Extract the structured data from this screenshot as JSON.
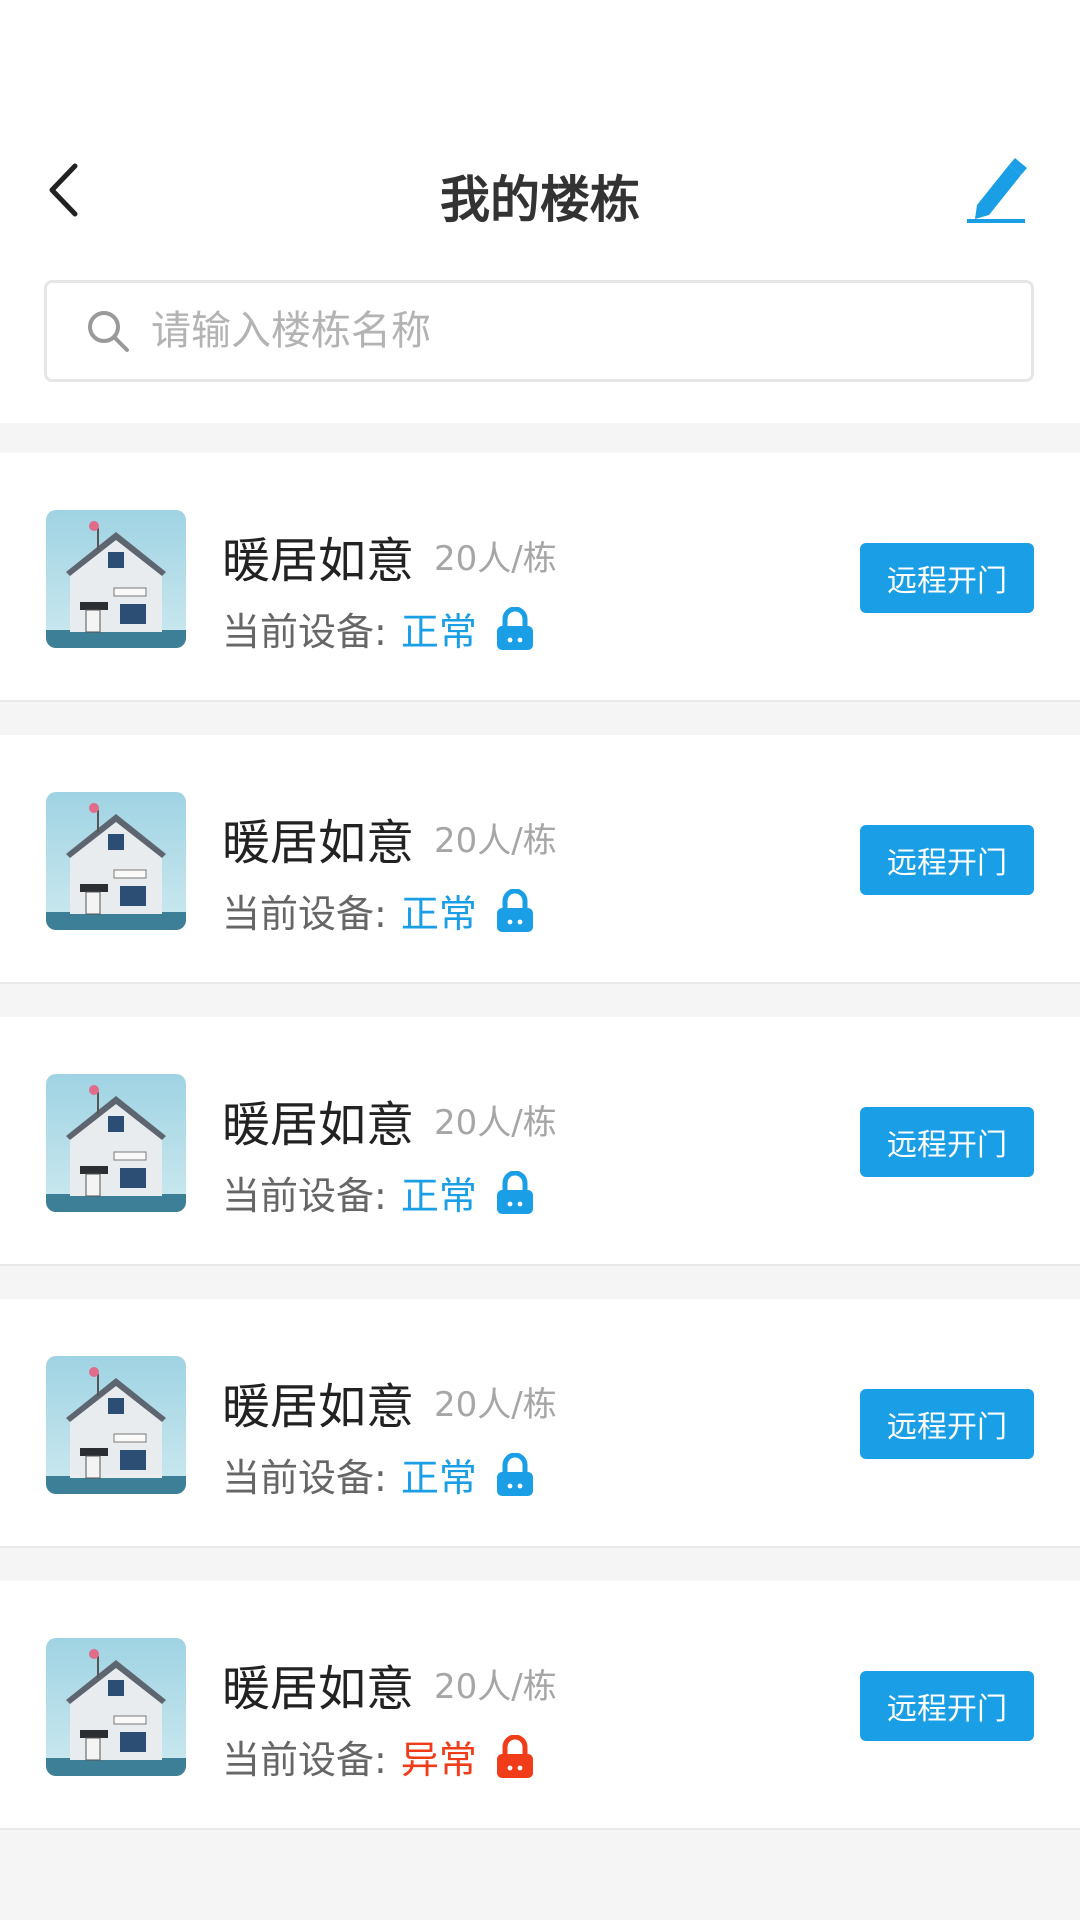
{
  "header": {
    "title": "我的楼栋"
  },
  "search": {
    "placeholder": "请输入楼栋名称"
  },
  "colors": {
    "accent": "#1a9ee5",
    "normal": "#1a9ee5",
    "abnormal": "#f03c19"
  },
  "buildings": [
    {
      "name": "暖居如意",
      "capacity": "20人/栋",
      "status_label": "当前设备:",
      "status": "正常",
      "state": "normal",
      "action": "远程开门"
    },
    {
      "name": "暖居如意",
      "capacity": "20人/栋",
      "status_label": "当前设备:",
      "status": "正常",
      "state": "normal",
      "action": "远程开门"
    },
    {
      "name": "暖居如意",
      "capacity": "20人/栋",
      "status_label": "当前设备:",
      "status": "正常",
      "state": "normal",
      "action": "远程开门"
    },
    {
      "name": "暖居如意",
      "capacity": "20人/栋",
      "status_label": "当前设备:",
      "status": "正常",
      "state": "normal",
      "action": "远程开门"
    },
    {
      "name": "暖居如意",
      "capacity": "20人/栋",
      "status_label": "当前设备:",
      "status": "异常",
      "state": "abnormal",
      "action": "远程开门"
    }
  ]
}
